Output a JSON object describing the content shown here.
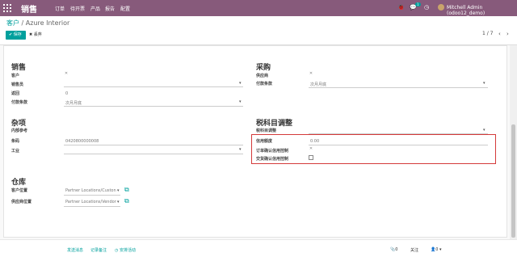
{
  "nav": {
    "brand": "销售",
    "menu": [
      "订单",
      "待开票",
      "产品",
      "报告",
      "配置"
    ],
    "chat_badge": "1",
    "user": "Mitchell Admin (odoo12_demo)"
  },
  "control": {
    "breadcrumb_parent": "客户",
    "breadcrumb_sep": "/",
    "breadcrumb_current": "Azure Interior",
    "save_label": "保存",
    "discard_label": "丢弃",
    "pager": "1 / 7",
    "prev": "‹",
    "next": "›"
  },
  "sales": {
    "heading": "销售",
    "customer_label": "客户",
    "salesperson_label": "销售员",
    "delivery_method_label": "返回",
    "delivery_method_value": "0",
    "payment_terms_label": "付款条款",
    "payment_terms_value": "次月月底"
  },
  "purchase": {
    "heading": "采购",
    "vendor_label": "供应商",
    "payment_terms_label": "付款条款",
    "payment_terms_value": "次月月底"
  },
  "misc": {
    "heading": "杂项",
    "internal_ref_label": "内部参考",
    "barcode_label": "条码",
    "barcode_value": "0420800000008",
    "industry_label": "工业"
  },
  "fiscal": {
    "heading": "税科目调整",
    "fiscal_position_label": "税科目调整",
    "credit_limit_label": "信用额度",
    "credit_limit_value": "0.00",
    "order_credit_label": "订单确认信用控制",
    "delivery_credit_label": "交货确认信用控制"
  },
  "warehouse": {
    "heading": "仓库",
    "customer_location_label": "客户位置",
    "customer_location_value": "Partner Locations/Custon",
    "vendor_location_label": "供应商位置",
    "vendor_location_value": "Partner Locations/Vendor"
  },
  "chatter": {
    "send_message": "发送消息",
    "log_note": "记录备注",
    "schedule_activity": "安排活动",
    "attachments": "0",
    "follow": "关注",
    "followers": "0"
  }
}
